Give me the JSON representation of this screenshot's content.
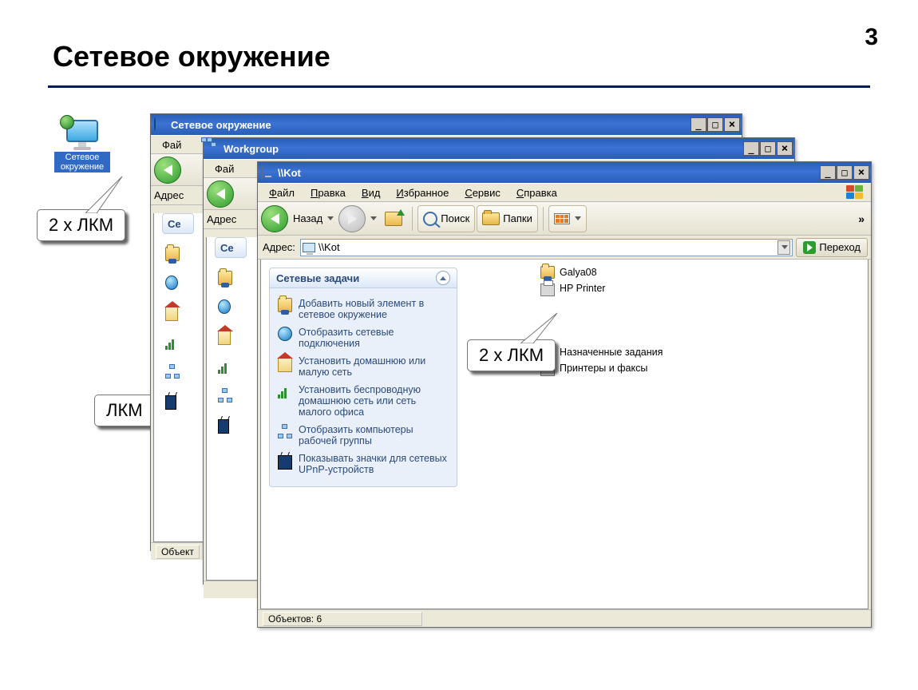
{
  "page_number": "3",
  "slide_title": "Сетевое окружение",
  "desktop_icon_label": "Сетевое окружение",
  "callouts": {
    "c1": "2 х ЛКМ",
    "c2": "ЛКМ",
    "c3": "2 х ЛКМ"
  },
  "win1": {
    "title": "Сетевое окружение",
    "menu_file_partial": "Фай",
    "addr_label": "Адрес",
    "panel_head_partial": "Се",
    "status": "Объект"
  },
  "win2": {
    "title": "Workgroup",
    "menu_file_partial": "Фай",
    "addr_label": "Адрес",
    "panel_head_partial": "Се"
  },
  "win3": {
    "title": "\\\\Kot",
    "menu": {
      "file": "Файл",
      "edit": "Правка",
      "view": "Вид",
      "fav": "Избранное",
      "tools": "Сервис",
      "help": "Справка"
    },
    "toolbar": {
      "back": "Назад",
      "search": "Поиск",
      "folders": "Папки",
      "more": "»"
    },
    "addr": {
      "label": "Адрес:",
      "value": "\\\\Kot",
      "go": "Переход"
    },
    "sidepanel": {
      "title": "Сетевые задачи",
      "tasks": [
        "Добавить новый элемент в сетевое окружение",
        "Отобразить сетевые подключения",
        "Установить домашнюю или малую сеть",
        "Установить беспроводную домашнюю сеть или сеть малого офиса",
        "Отобразить компьютеры рабочей группы",
        "Показывать значки для сетевых UPnP-устройств"
      ]
    },
    "files": [
      "Galya08",
      "HP Printer",
      "Назначенные задания",
      "Принтеры и факсы"
    ],
    "status": "Объектов: 6"
  }
}
